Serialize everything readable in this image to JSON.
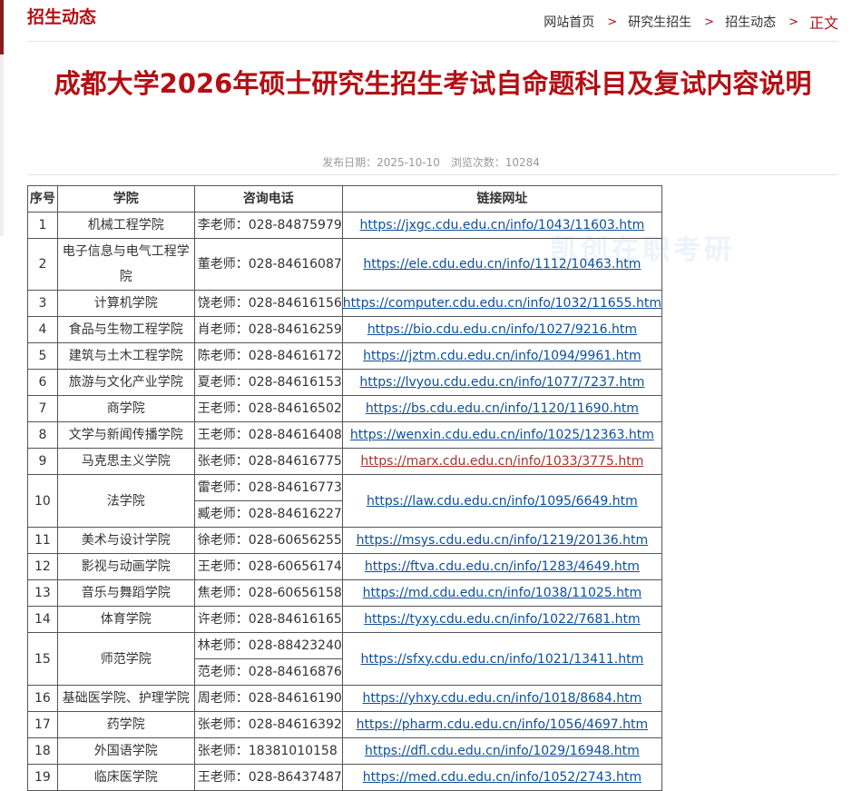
{
  "section_title": "招生动态",
  "breadcrumb": {
    "items": [
      "网站首页",
      "研究生招生",
      "招生动态"
    ],
    "separator": ">",
    "current": "正文"
  },
  "article": {
    "title": "成都大学2026年硕士研究生招生考试自命题科目及复试内容说明",
    "publish_date_label": "发布日期：2025-10-10",
    "views_label": "浏览次数：10284"
  },
  "watermark": "凯创在职考研",
  "table": {
    "headers": [
      "序号",
      "学院",
      "咨询电话",
      "链接网址"
    ],
    "rows": [
      {
        "no": "1",
        "college": "机械工程学院",
        "phones": [
          "李老师：028-84875979"
        ],
        "url": "https://jxgc.cdu.edu.cn/info/1043/11603.htm"
      },
      {
        "no": "2",
        "college": "电子信息与电气工程学院",
        "phones": [
          "董老师：028-84616087"
        ],
        "url": "https://ele.cdu.edu.cn/info/1112/10463.htm"
      },
      {
        "no": "3",
        "college": "计算机学院",
        "phones": [
          "饶老师：028-84616156"
        ],
        "url": "https://computer.cdu.edu.cn/info/1032/11655.htm"
      },
      {
        "no": "4",
        "college": "食品与生物工程学院",
        "phones": [
          "肖老师：028-84616259"
        ],
        "url": "https://bio.cdu.edu.cn/info/1027/9216.htm"
      },
      {
        "no": "5",
        "college": "建筑与土木工程学院",
        "phones": [
          "陈老师：028-84616172"
        ],
        "url": "https://jztm.cdu.edu.cn/info/1094/9961.htm"
      },
      {
        "no": "6",
        "college": "旅游与文化产业学院",
        "phones": [
          "夏老师：028-84616153"
        ],
        "url": "https://lvyou.cdu.edu.cn/info/1077/7237.htm"
      },
      {
        "no": "7",
        "college": "商学院",
        "phones": [
          "王老师：028-84616502"
        ],
        "url": "https://bs.cdu.edu.cn/info/1120/11690.htm"
      },
      {
        "no": "8",
        "college": "文学与新闻传播学院",
        "phones": [
          "王老师：028-84616408"
        ],
        "url": "https://wenxin.cdu.edu.cn/info/1025/12363.htm"
      },
      {
        "no": "9",
        "college": "马克思主义学院",
        "phones": [
          "张老师：028-84616775"
        ],
        "url": "https://marx.cdu.edu.cn/info/1033/3775.htm",
        "visited": true
      },
      {
        "no": "10",
        "college": "法学院",
        "phones": [
          "雷老师：028-84616773",
          "臧老师：028-84616227"
        ],
        "url": "https://law.cdu.edu.cn/info/1095/6649.htm"
      },
      {
        "no": "11",
        "college": "美术与设计学院",
        "phones": [
          "徐老师：028-60656255"
        ],
        "url": "https://msys.cdu.edu.cn/info/1219/20136.htm"
      },
      {
        "no": "12",
        "college": "影视与动画学院",
        "phones": [
          "王老师：028-60656174"
        ],
        "url": "https://ftva.cdu.edu.cn/info/1283/4649.htm"
      },
      {
        "no": "13",
        "college": "音乐与舞蹈学院",
        "phones": [
          "焦老师：028-60656158"
        ],
        "url": "https://md.cdu.edu.cn/info/1038/11025.htm"
      },
      {
        "no": "14",
        "college": "体育学院",
        "phones": [
          "许老师：028-84616165"
        ],
        "url": "https://tyxy.cdu.edu.cn/info/1022/7681.htm"
      },
      {
        "no": "15",
        "college": "师范学院",
        "phones": [
          "林老师：028-88423240",
          "范老师：028-84616876"
        ],
        "url": "https://sfxy.cdu.edu.cn/info/1021/13411.htm"
      },
      {
        "no": "16",
        "college": "基础医学院、护理学院",
        "phones": [
          "周老师：028-84616190"
        ],
        "url": "https://yhxy.cdu.edu.cn/info/1018/8684.htm"
      },
      {
        "no": "17",
        "college": "药学院",
        "phones": [
          "张老师：028-84616392"
        ],
        "url": "https://pharm.cdu.edu.cn/info/1056/4697.htm"
      },
      {
        "no": "18",
        "college": "外国语学院",
        "phones": [
          "张老师：18381010158"
        ],
        "url": "https://dfl.cdu.edu.cn/info/1029/16948.htm"
      },
      {
        "no": "19",
        "college": "临床医学院",
        "phones": [
          "王老师：028-86437487"
        ],
        "url": "https://med.cdu.edu.cn/info/1052/2743.htm"
      }
    ]
  },
  "colors": {
    "brand_red": "#b30f14",
    "link_blue": "#0b4f9c",
    "link_visited": "#a8322e"
  }
}
